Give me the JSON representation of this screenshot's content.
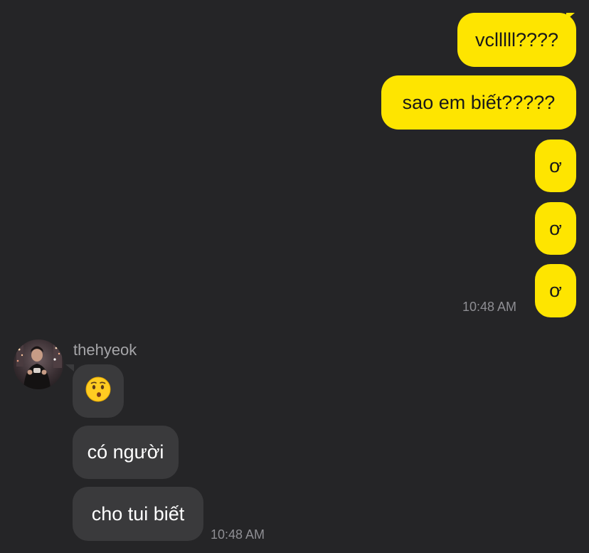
{
  "colors": {
    "background": "#252527",
    "outgoing_bubble": "#FEE500",
    "incoming_bubble": "#3A3A3C",
    "timestamp": "#8E8E93"
  },
  "outgoing": {
    "messages": [
      {
        "text": "vclllll????"
      },
      {
        "text": "sao em biết?????"
      },
      {
        "text": "ơ"
      },
      {
        "text": "ơ"
      },
      {
        "text": "ơ"
      }
    ],
    "time": "10:48 AM"
  },
  "incoming": {
    "sender": "thehyeok",
    "avatar": "profile-photo",
    "messages": [
      {
        "text": "😗"
      },
      {
        "text": "có người"
      },
      {
        "text": "cho tui biết"
      }
    ],
    "time": "10:48 AM"
  }
}
